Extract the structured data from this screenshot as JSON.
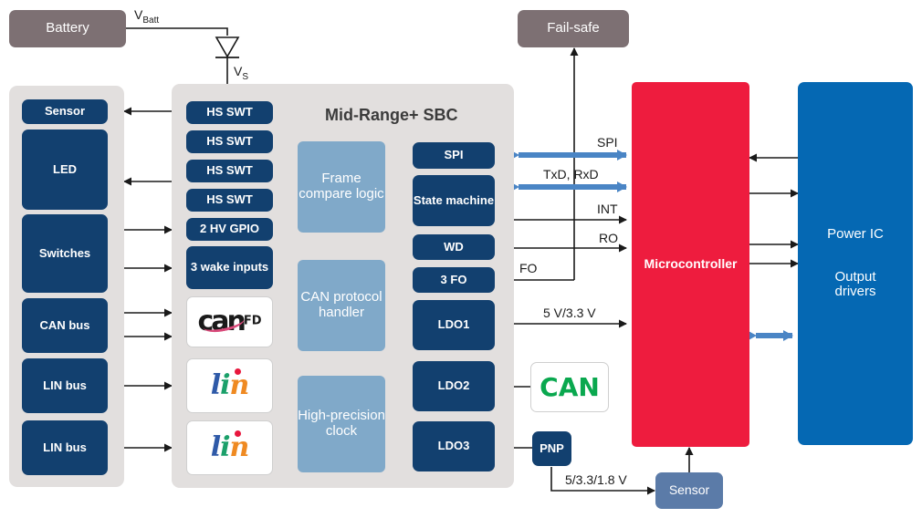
{
  "diagram": {
    "title": "Mid-Range+ SBC",
    "colors": {
      "navy": "#12406f",
      "light_blue": "#80a9c9",
      "panel_gray": "#e2dfde",
      "mauve": "#7d7073",
      "red": "#ee1c3e",
      "power_blue": "#0568b3",
      "slate": "#5b7ba8",
      "can_green": "#0aa84f"
    }
  },
  "power": {
    "battery_label": "Battery",
    "vbatt_label": "V",
    "vbatt_sub": "Batt",
    "vs_label": "V",
    "vs_sub": "S",
    "diode_name": "reverse-polarity-diode"
  },
  "failsafe": {
    "label": "Fail-safe"
  },
  "loads": [
    {
      "label": "Sensor"
    },
    {
      "label": "LED"
    },
    {
      "label": "Switches"
    },
    {
      "label": "CAN bus"
    },
    {
      "label": "LIN bus"
    },
    {
      "label": "LIN bus"
    }
  ],
  "sbc_inputs": [
    {
      "label": "HS SWT",
      "type": "navy"
    },
    {
      "label": "HS SWT",
      "type": "navy"
    },
    {
      "label": "HS SWT",
      "type": "navy"
    },
    {
      "label": "HS SWT",
      "type": "navy"
    },
    {
      "label": "2 HV GPIO",
      "type": "navy"
    },
    {
      "label": "3 wake inputs",
      "type": "navy"
    },
    {
      "label": "CAN FD",
      "type": "logo-canfd"
    },
    {
      "label": "lin",
      "type": "logo-lin"
    },
    {
      "label": "lin",
      "type": "logo-lin"
    }
  ],
  "sbc_logic": [
    {
      "label": "Frame compare logic"
    },
    {
      "label": "CAN protocol handler"
    },
    {
      "label": "High-precision clock"
    }
  ],
  "sbc_functions": [
    {
      "label": "SPI"
    },
    {
      "label": "State machine"
    },
    {
      "label": "WD"
    },
    {
      "label": "3 FO"
    },
    {
      "label": "LDO1"
    },
    {
      "label": "LDO2"
    },
    {
      "label": "LDO3"
    }
  ],
  "signals": [
    {
      "label": "SPI"
    },
    {
      "label": "TxD, RxD"
    },
    {
      "label": "INT"
    },
    {
      "label": "RO"
    },
    {
      "label": "FO"
    },
    {
      "label": "5 V/3.3 V"
    },
    {
      "label": "5/3.3/1.8 V"
    }
  ],
  "microcontroller": {
    "label": "Microcontroller"
  },
  "power_ic": {
    "line1": "Power IC",
    "line2": "Output drivers"
  },
  "peripherals": {
    "can_transceiver": "CAN",
    "pnp": "PNP",
    "sensor": "Sensor"
  }
}
